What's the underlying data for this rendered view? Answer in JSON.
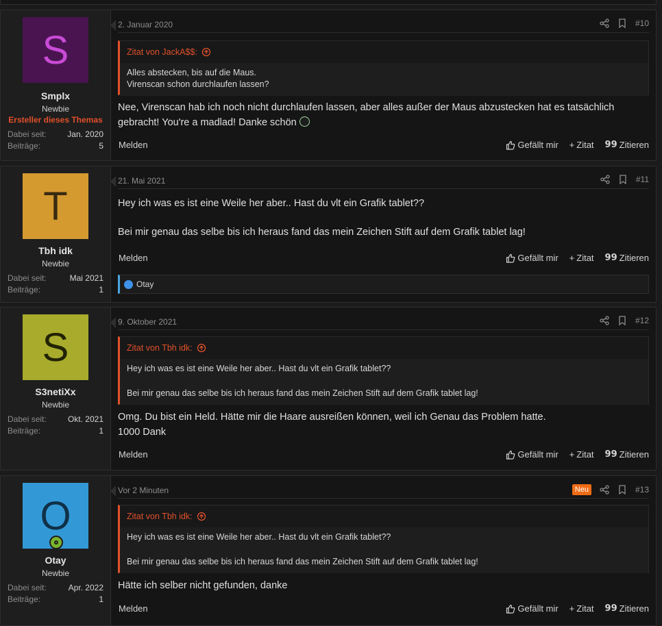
{
  "actions": {
    "melden": "Melden",
    "like": "Gefällt mir",
    "quote": "Zitat",
    "reply": "Zitieren"
  },
  "stat_labels": {
    "joined": "Dabei seit:",
    "posts": "Beiträge:"
  },
  "posts": [
    {
      "number": "#10",
      "date": "2. Januar 2020",
      "user": {
        "initial": "S",
        "name": "Smplx",
        "title": "Newbie",
        "badge": "Ersteller dieses Themas",
        "joined": "Jan. 2020",
        "posts": "5",
        "avatar_bg": "#4a1450",
        "avatar_fg": "#c84bd6"
      },
      "quote": {
        "head": "Zitat von JackA$$:",
        "lines": [
          "Alles abstecken, bis auf die Maus.",
          "Virenscan schon durchlaufen lassen?"
        ]
      },
      "body": [
        "Nee, Virenscan hab ich noch nicht durchlaufen lassen, aber alles außer der Maus abzustecken hat es tatsächlich",
        "gebracht! You're a madlad! Danke schön"
      ]
    },
    {
      "number": "#11",
      "date": "21. Mai 2021",
      "user": {
        "initial": "T",
        "name": "Tbh idk",
        "title": "Newbie",
        "joined": "Mai 2021",
        "posts": "1",
        "avatar_bg": "#d49a30",
        "avatar_fg": "#3a2a10"
      },
      "body": [
        "Hey ich was es ist eine Weile her aber.. Hast du vlt ein Grafik tablet??",
        "Bei mir genau das selbe bis ich heraus fand das mein Zeichen Stift auf dem Grafik tablet lag!"
      ],
      "reaction": "Otay"
    },
    {
      "number": "#12",
      "date": "9. Oktober 2021",
      "user": {
        "initial": "S",
        "name": "S3netiXx",
        "title": "Newbie",
        "joined": "Okt. 2021",
        "posts": "1",
        "avatar_bg": "#a8ab2b",
        "avatar_fg": "#222205"
      },
      "quote": {
        "head": "Zitat von Tbh idk:",
        "lines": [
          "Hey ich was es ist eine Weile her aber.. Hast du vlt ein Grafik tablet??",
          "Bei mir genau das selbe bis ich heraus fand das mein Zeichen Stift auf dem Grafik tablet lag!"
        ]
      },
      "body": [
        "Omg. Du bist ein Held. Hätte mir die Haare ausreißen können, weil ich Genau das Problem hatte.",
        "1000 Dank"
      ]
    },
    {
      "number": "#13",
      "date": "Vor 2 Minuten",
      "new": "Neu",
      "user": {
        "initial": "O",
        "name": "Otay",
        "title": "Newbie",
        "joined": "Apr. 2022",
        "posts": "1",
        "avatar_bg": "#3399d6",
        "avatar_fg": "#103048"
      },
      "quote": {
        "head": "Zitat von Tbh idk:",
        "lines": [
          "Hey ich was es ist eine Weile her aber.. Hast du vlt ein Grafik tablet??",
          "Bei mir genau das selbe bis ich heraus fand das mein Zeichen Stift auf dem Grafik tablet lag!"
        ]
      },
      "body": [
        "Hätte ich selber nicht gefunden, danke"
      ]
    }
  ]
}
